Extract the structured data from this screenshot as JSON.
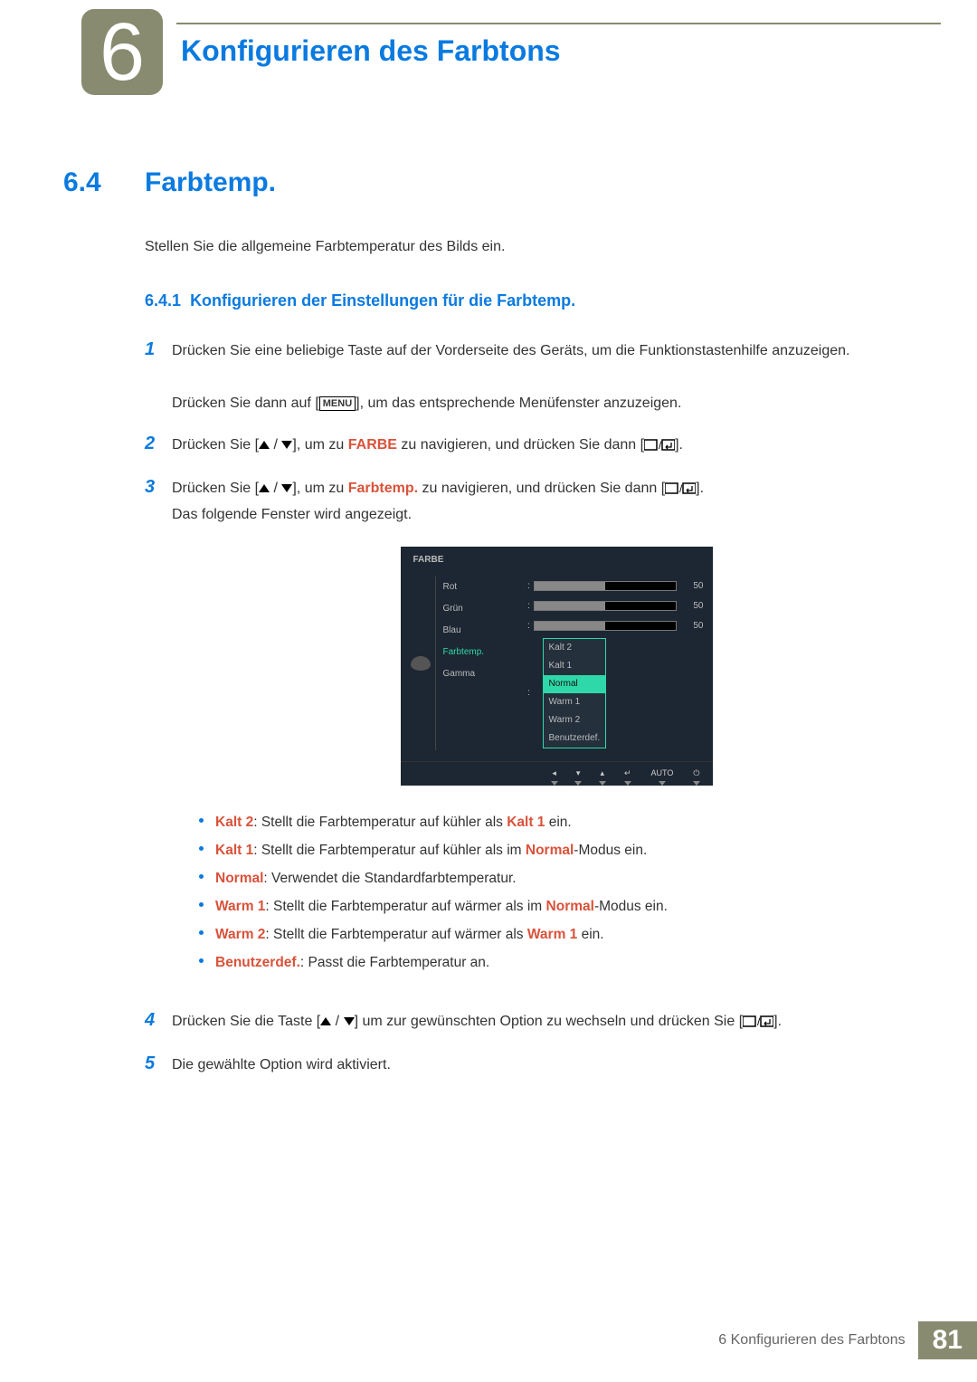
{
  "chapter": {
    "number": "6",
    "title": "Konfigurieren des Farbtons"
  },
  "section": {
    "number": "6.4",
    "title": "Farbtemp."
  },
  "intro": "Stellen Sie die allgemeine Farbtemperatur des Bilds ein.",
  "subsection": {
    "number": "6.4.1",
    "title": "Konfigurieren der Einstellungen für die Farbtemp."
  },
  "steps": {
    "s1": "Drücken Sie eine beliebige Taste auf der Vorderseite des Geräts, um die Funktionstastenhilfe anzuzeigen.",
    "s1b_pre": "Drücken Sie dann auf [",
    "s1b_key": "MENU",
    "s1b_post": "], um das entsprechende Menüfenster anzuzeigen.",
    "s2_pre": "Drücken Sie [",
    "s2_mid": "], um zu ",
    "s2_kw": "FARBE",
    "s2_post": " zu navigieren, und drücken Sie dann [",
    "s2_end": "].",
    "s3_pre": "Drücken Sie [",
    "s3_mid": "], um zu ",
    "s3_kw": "Farbtemp.",
    "s3_post": " zu navigieren, und drücken Sie dann [",
    "s3_end": "].",
    "s3b": "Das folgende Fenster wird angezeigt.",
    "s4_pre": "Drücken Sie die Taste [",
    "s4_mid": "] um zur gewünschten Option zu wechseln und drücken Sie [",
    "s4_end": "].",
    "s5": "Die gewählte Option wird aktiviert."
  },
  "osd": {
    "title": "FARBE",
    "labels": {
      "rot": "Rot",
      "gruen": "Grün",
      "blau": "Blau",
      "farbtemp": "Farbtemp.",
      "gamma": "Gamma"
    },
    "value": "50",
    "options": {
      "k2": "Kalt 2",
      "k1": "Kalt 1",
      "nm": "Normal",
      "w1": "Warm 1",
      "w2": "Warm 2",
      "bd": "Benutzerdef."
    },
    "footer": {
      "auto": "AUTO"
    }
  },
  "bullets": {
    "b1_k": "Kalt 2",
    "b1_t": ": Stellt die Farbtemperatur auf kühler als ",
    "b1_k2": "Kalt 1",
    "b1_e": " ein.",
    "b2_k": "Kalt 1",
    "b2_t": ": Stellt die Farbtemperatur auf kühler als im ",
    "b2_k2": "Normal",
    "b2_e": "-Modus ein.",
    "b3_k": "Normal",
    "b3_t": ": Verwendet die Standardfarbtemperatur.",
    "b4_k": "Warm 1",
    "b4_t": ": Stellt die Farbtemperatur auf wärmer als im ",
    "b4_k2": "Normal",
    "b4_e": "-Modus ein.",
    "b5_k": "Warm 2",
    "b5_t": ": Stellt die Farbtemperatur auf wärmer als ",
    "b5_k2": "Warm 1",
    "b5_e": " ein.",
    "b6_k": "Benutzerdef.",
    "b6_t": ": Passt die Farbtemperatur an."
  },
  "footer": {
    "text": "6 Konfigurieren des Farbtons",
    "page": "81"
  }
}
